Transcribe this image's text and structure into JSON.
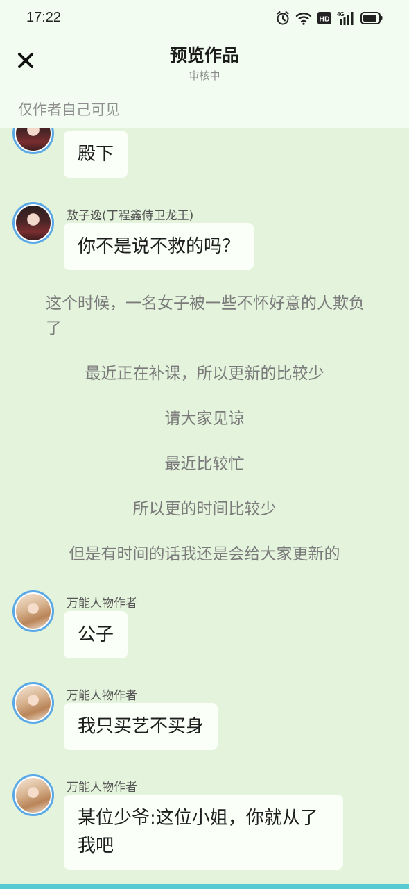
{
  "status": {
    "time": "17:22",
    "icons": [
      "alarm-icon",
      "wifi-icon",
      "hd-icon",
      "4g-signal-icon",
      "battery-icon"
    ],
    "network_label": "4G",
    "hd_label": "HD"
  },
  "header": {
    "title": "预览作品",
    "subtitle": "审核中",
    "close_icon": "close-icon"
  },
  "notice": "仅作者自己可见",
  "messages": [
    {
      "name": "",
      "text": "殿下"
    },
    {
      "name": "敖子逸(丁程鑫侍卫龙王)",
      "text": "你不是说不救的吗？"
    },
    {
      "name": "万能人物作者",
      "text": "公子"
    },
    {
      "name": "万能人物作者",
      "text": "我只买艺不买身"
    },
    {
      "name": "万能人物作者",
      "text": "某位少爷:这位小姐，你就从了我吧"
    }
  ],
  "narrations": [
    "这个时候，一名女子被一些不怀好意的人欺负了",
    "最近正在补课，所以更新的比较少",
    "请大家见谅",
    "最近比较忙",
    "所以更的时间比较少",
    "但是有时间的话我还是会给大家更新的"
  ],
  "colors": {
    "background": "#e4f3dc",
    "header_bg": "#f2fcf0",
    "bubble_bg": "#fafff8",
    "avatar_border": "#5aa9e6",
    "accent_bar": "#57cbd1"
  }
}
